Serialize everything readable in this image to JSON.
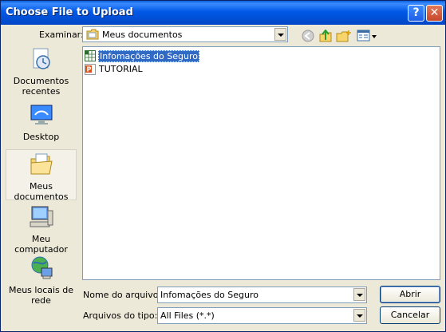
{
  "window": {
    "title": "Choose File to Upload",
    "help_glyph": "?",
    "close_glyph": "✕"
  },
  "lookin": {
    "label": "Examinar:",
    "value": "Meus documentos"
  },
  "toolbar": {
    "back_icon": "back-arrow-icon",
    "up_icon": "up-folder-icon",
    "new_folder_icon": "new-folder-icon",
    "view_icon": "view-menu-icon"
  },
  "places": [
    {
      "label": "Documentos recentes",
      "icon": "recent-documents-icon"
    },
    {
      "label": "Desktop",
      "icon": "desktop-icon"
    },
    {
      "label": "Meus documentos",
      "icon": "my-documents-icon",
      "selected": true
    },
    {
      "label": "Meu computador",
      "icon": "my-computer-icon"
    },
    {
      "label": "Meus locais de rede",
      "icon": "network-places-icon"
    }
  ],
  "files": [
    {
      "name": "Infomações do Seguro",
      "icon": "spreadsheet-file-icon",
      "selected": true
    },
    {
      "name": "TUTORIAL",
      "icon": "presentation-file-icon",
      "selected": false
    }
  ],
  "filename": {
    "label": "Nome do arquivo:",
    "value": "Infomações do Seguro"
  },
  "filetype": {
    "label": "Arquivos do tipo:",
    "value": "All Files (*.*)"
  },
  "buttons": {
    "open": "Abrir",
    "cancel": "Cancelar"
  },
  "colors": {
    "titlebar": "#0058e6",
    "dialog_bg": "#ece9d8",
    "selection": "#316ac5"
  }
}
